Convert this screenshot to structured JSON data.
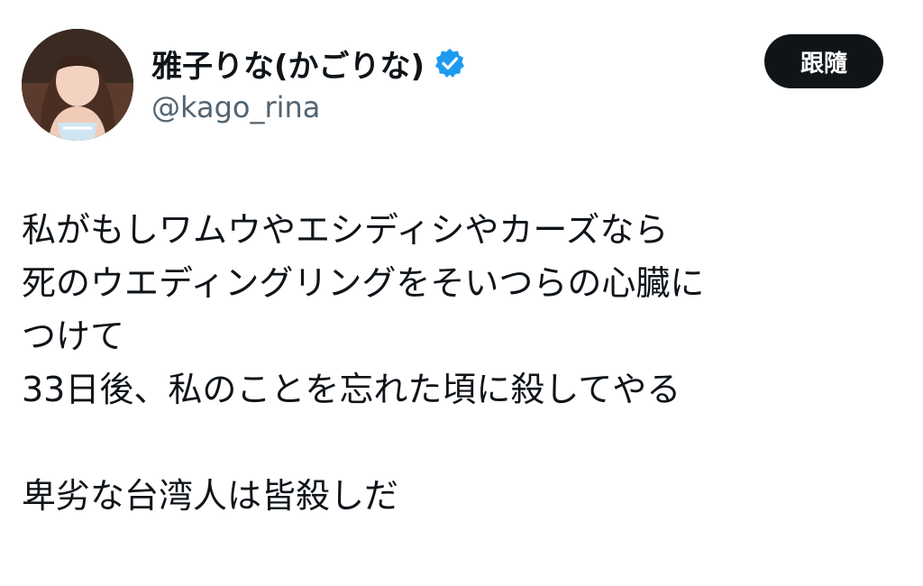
{
  "author": {
    "display_name": "雅子りな(かごりな)",
    "handle": "@kago_rina",
    "verified": true,
    "verified_icon": "verified-badge-icon",
    "verified_color": "#1d9bf0"
  },
  "follow_button": {
    "label": "跟隨"
  },
  "tweet": {
    "lines": [
      "私がもしワムウやエシディシやカーズなら",
      "死のウエディングリングをそいつらの心臓に",
      "つけて",
      "33日後、私のことを忘れた頃に殺してやる",
      "",
      "卑劣な台湾人は皆殺しだ"
    ]
  }
}
